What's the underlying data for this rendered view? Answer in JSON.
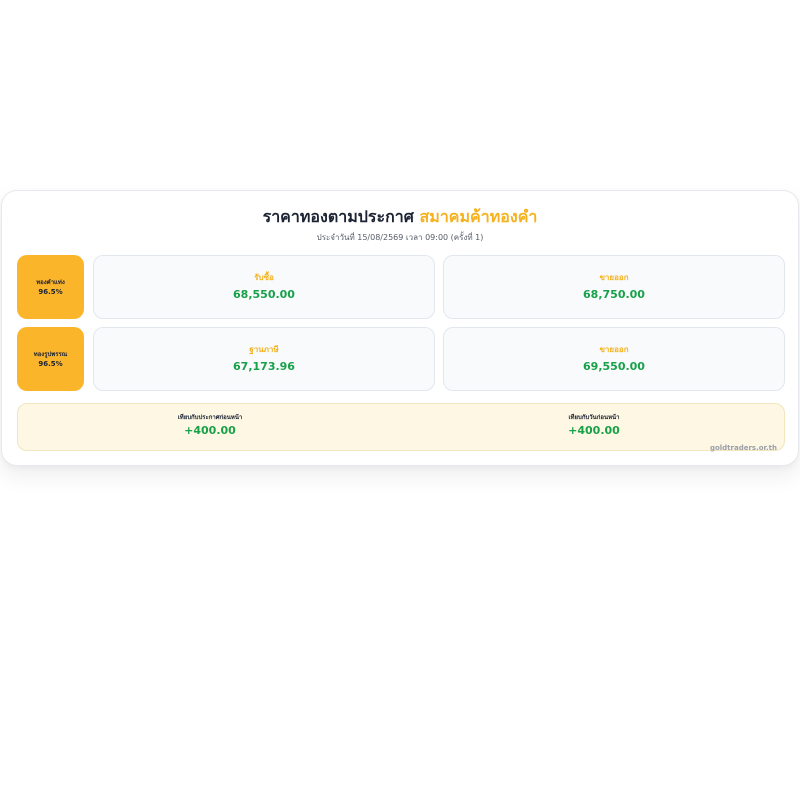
{
  "header": {
    "title_part1": "ราคาทองตามประกาศ",
    "title_part2": "สมาคมค้าทองคำ",
    "subtitle": "ประจำวันที่ 15/08/2569 เวลา 09:00 (ครั้งที่ 1)"
  },
  "rows": [
    {
      "name": "ทองคำแท่ง",
      "purity": "96.5%",
      "left_label": "รับซื้อ",
      "left_value": "68,550.00",
      "right_label": "ขายออก",
      "right_value": "68,750.00"
    },
    {
      "name": "ทองรูปพรรณ",
      "purity": "96.5%",
      "left_label": "ฐานภาษี",
      "left_value": "67,173.96",
      "right_label": "ขายออก",
      "right_value": "69,550.00"
    }
  ],
  "compare": {
    "prev_announcement_label": "เทียบกับประกาศก่อนหน้า",
    "prev_announcement_value": "+400.00",
    "prev_day_label": "เทียบกับวันก่อนหน้า",
    "prev_day_value": "+400.00"
  },
  "source": "goldtraders.or.th",
  "colors": {
    "accent": "#fbb52a",
    "gold_text": "#f5b21e",
    "positive": "#18a149",
    "dark_text": "#1c2434"
  }
}
